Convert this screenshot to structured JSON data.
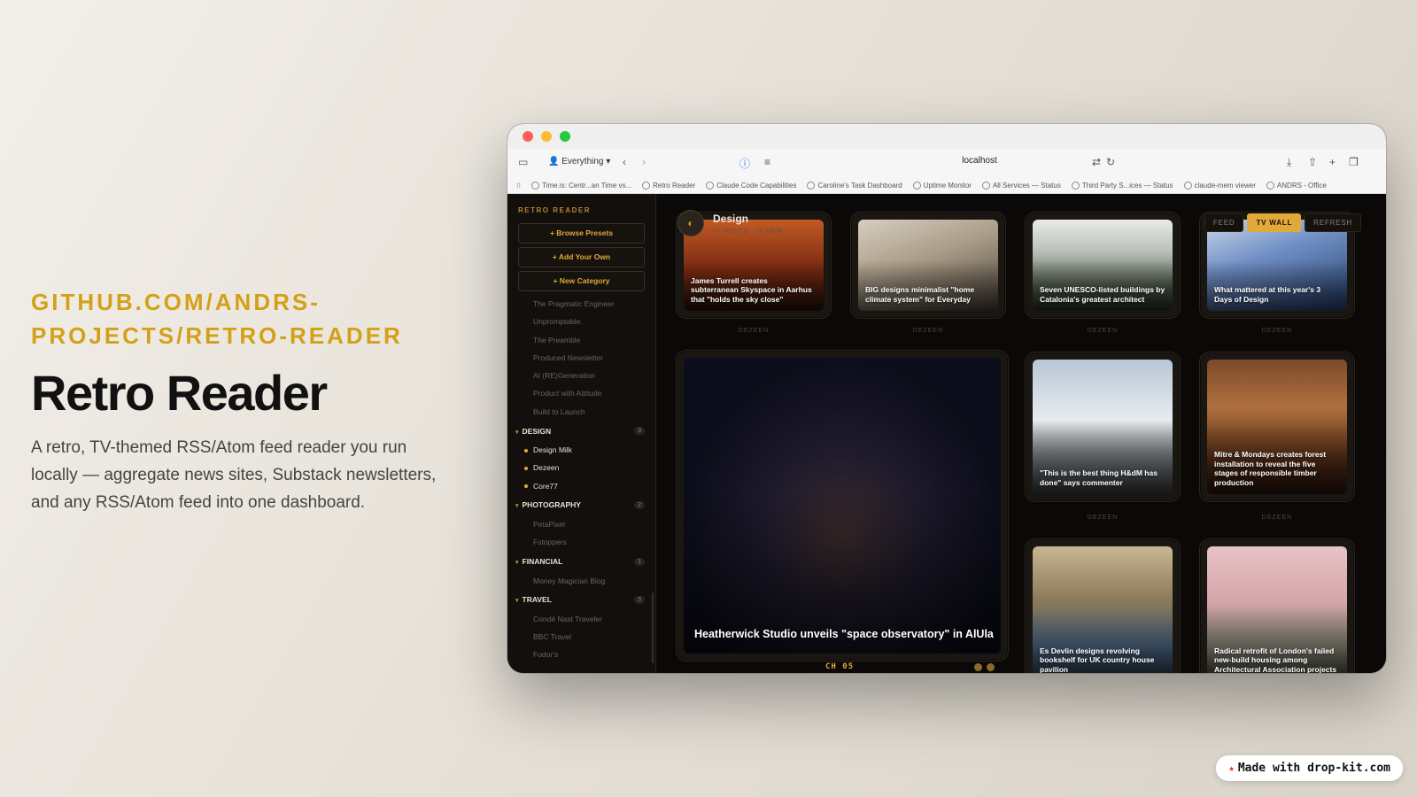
{
  "promo": {
    "repo": "GITHUB.COM/ANDRS-PROJECTS/RETRO-READER",
    "title": "Retro Reader",
    "description": "A retro, TV-themed RSS/Atom feed reader you run locally — aggregate news sites, Substack newsletters, and any RSS/Atom feed into one dashboard."
  },
  "browser": {
    "profile": "Everything",
    "url": "localhost",
    "bookmarks": [
      "Time.is: Centr...an Time vs...",
      "Retro Reader",
      "Claude Code Capabilities",
      "Caroline's Task Dashboard",
      "Uptime Monitor",
      "All Services — Status",
      "Third Party S...ices — Status",
      "claude-mem viewer",
      "ANDRS - Office"
    ]
  },
  "sidebar": {
    "title": "RETRO READER",
    "buttons": [
      "+ Browse Presets",
      "+ Add Your Own",
      "+ New Category"
    ],
    "feeds_top": [
      "The Pragmatic Engineer",
      "Unpromptable.",
      "The Preamble",
      "Produced Newsletter",
      "AI (RE)Generation",
      "Product with Attitude",
      "Build to Launch"
    ],
    "categories": [
      {
        "name": "DESIGN",
        "count": "3",
        "feeds": [
          "Design Milk",
          "Dezeen",
          "Core77"
        ]
      },
      {
        "name": "PHOTOGRAPHY",
        "count": "2",
        "feeds": [
          "PetaPixel",
          "Fstoppers"
        ]
      },
      {
        "name": "FINANCIAL",
        "count": "1",
        "feeds": [
          "Money Magician Blog"
        ]
      },
      {
        "name": "TRAVEL",
        "count": "3",
        "feeds": [
          "Condé Nast Traveler",
          "BBC Travel",
          "Fodor's"
        ]
      }
    ]
  },
  "main": {
    "title": "Design",
    "subtitle": "77 POSTS · 75 NEW",
    "modes": [
      "FEED",
      "TV WALL",
      "REFRESH"
    ],
    "active_mode": "TV WALL",
    "channel": "CH 05",
    "tiles": [
      {
        "caption": "James Turrell creates subterranean Skyspace in Aarhus that \"holds the sky close\"",
        "source": "DEZEEN"
      },
      {
        "caption": "BIG designs minimalist \"home climate system\" for Everyday",
        "source": "DEZEEN"
      },
      {
        "caption": "Seven UNESCO-listed buildings by Catalonia's greatest architect",
        "source": "DEZEEN"
      },
      {
        "caption": "What mattered at this year's 3 Days of Design",
        "source": "DEZEEN"
      },
      {
        "caption": "Heatherwick Studio unveils \"space observatory\" in AlUla",
        "source": ""
      },
      {
        "caption": "\"This is the best thing H&dM has done\" says commenter",
        "source": "DEZEEN"
      },
      {
        "caption": "Mitre & Mondays creates forest installation to reveal the five stages of responsible timber production",
        "source": "DEZEEN"
      },
      {
        "caption": "Es Devlin designs revolving bookshelf for UK country house pavilion",
        "source": ""
      },
      {
        "caption": "Radical retrofit of London's failed new-build housing among Architectural Association projects",
        "source": ""
      }
    ]
  },
  "badge": {
    "text": "Made with drop-kit.com"
  },
  "colors": {
    "accent": "#e0a93a",
    "repo": "#d4a017",
    "bg_dark": "#0b0907"
  }
}
